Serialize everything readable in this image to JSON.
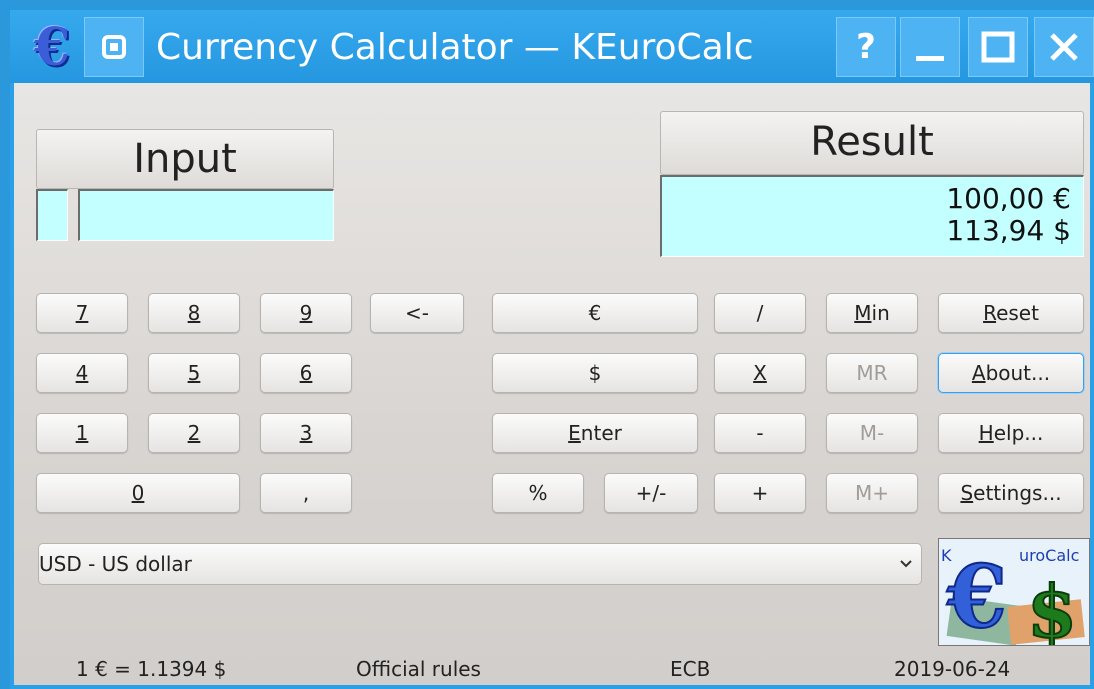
{
  "window": {
    "title": "Currency Calculator — KEuroCalc",
    "icon": "euro-icon",
    "buttons": {
      "help": "?",
      "minimize": "minimize-icon",
      "maximize": "maximize-icon",
      "close": "close-icon"
    }
  },
  "input_panel": {
    "label": "Input",
    "operator_value": "",
    "value": ""
  },
  "result_panel": {
    "label": "Result",
    "line1": "100,00 €",
    "line2": "113,94 $"
  },
  "keypad": {
    "digits": {
      "d7": "7",
      "d8": "8",
      "d9": "9",
      "d4": "4",
      "d5": "5",
      "d6": "6",
      "d1": "1",
      "d2": "2",
      "d3": "3",
      "d0": "0",
      "comma": ",",
      "backspace": "<-"
    },
    "currency": {
      "euro": "€",
      "dollar": "$",
      "enter": "Enter"
    },
    "ops": {
      "divide": "/",
      "multiply": "X",
      "minus": "-",
      "plus": "+",
      "percent": "%",
      "sign": "+/-"
    },
    "memory": {
      "min": "Min",
      "mr": "MR",
      "mminus": "M-",
      "mplus": "M+"
    },
    "actions": {
      "reset": "Reset",
      "about": "About...",
      "help": "Help...",
      "settings": "Settings..."
    }
  },
  "currency_select": {
    "selected": "USD - US dollar"
  },
  "logo_text": "KEuroCalc",
  "status": {
    "rate": "1 € = 1.1394 $",
    "rules": "Official rules",
    "source": "ECB",
    "date": "2019-06-24"
  },
  "colors": {
    "titlebar": "#2597e0",
    "display": "#c4ffff",
    "background": "#dcd8d5"
  }
}
